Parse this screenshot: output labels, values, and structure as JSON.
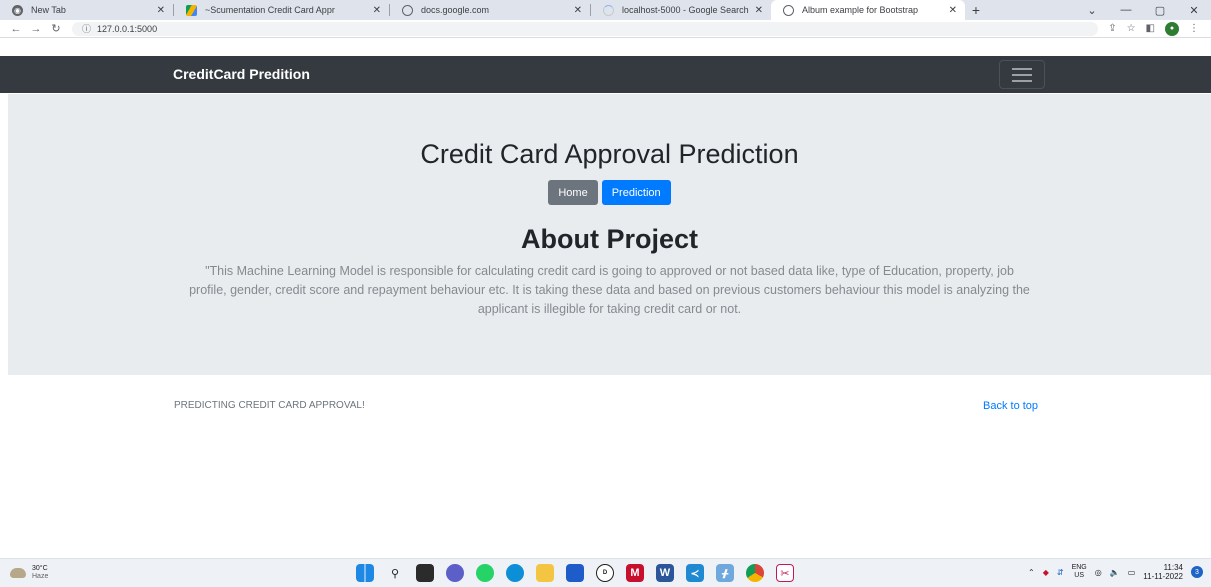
{
  "browser": {
    "tabs": [
      {
        "title": "New Tab",
        "active": false
      },
      {
        "title": "~Scumentation Credit Card Appr",
        "active": false
      },
      {
        "title": "docs.google.com",
        "active": false
      },
      {
        "title": "localhost-5000 - Google Search",
        "active": false
      },
      {
        "title": "Album example for Bootstrap",
        "active": true
      }
    ],
    "new_tab_glyph": "+",
    "url": "127.0.0.1:5000"
  },
  "navbar": {
    "brand": "CreditCard Predition"
  },
  "hero": {
    "title": "Credit Card Approval Prediction",
    "buttons": {
      "home": "Home",
      "prediction": "Prediction"
    },
    "about_title": "About Project",
    "about_text": "\"This Machine Learning Model is responsible for calculating credit card is going to approved or not based data like, type of Education, property, job profile, gender, credit score and repayment behaviour etc. It is taking these data and based on previous customers behaviour this model is analyzing the applicant is illegible for taking credit card or not."
  },
  "footer": {
    "tagline": "PREDICTING CREDIT CARD APPROVAL!",
    "back_to_top": "Back to top"
  },
  "taskbar": {
    "temperature": "30°C",
    "condition": "Haze",
    "lang_top": "ENG",
    "lang_bottom": "US",
    "time": "11:34",
    "date": "11-11-2022",
    "notifications": "3"
  },
  "colors": {
    "navbar_bg": "#343a40",
    "jumbotron_bg": "#e9ecef",
    "primary": "#007bff",
    "secondary": "#6c757d"
  }
}
